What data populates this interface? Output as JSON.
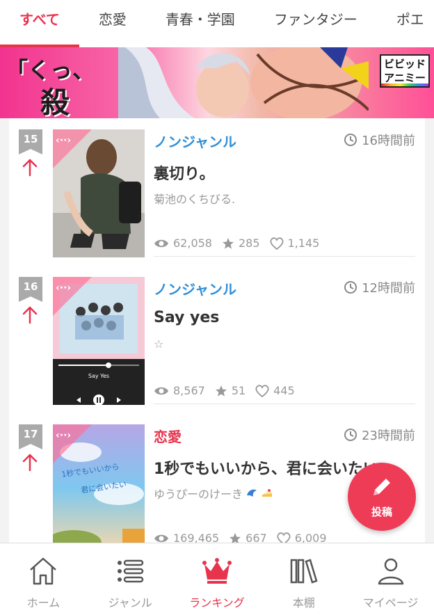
{
  "tabs": [
    {
      "label": "すべて",
      "active": true
    },
    {
      "label": "恋愛",
      "active": false
    },
    {
      "label": "青春・学園",
      "active": false
    },
    {
      "label": "ファンタジー",
      "active": false
    },
    {
      "label": "ポエ",
      "active": false
    }
  ],
  "banner": {
    "line1": "「くっ、",
    "line2": "殺せ!」",
    "logo_line1": "ビビッド",
    "logo_line2": "アニミー"
  },
  "items": [
    {
      "rank": "15",
      "trend": "up",
      "genre": "ノンジャンル",
      "time": "16時間前",
      "title": "裏切り。",
      "author": "菊池のくちびる.",
      "views": "62,058",
      "stars": "285",
      "likes": "1,145"
    },
    {
      "rank": "16",
      "trend": "up",
      "genre": "ノンジャンル",
      "time": "12時間前",
      "title": "Say yes",
      "author": "☆",
      "views": "8,567",
      "stars": "51",
      "likes": "445",
      "thumb_song": "Say Yes"
    },
    {
      "rank": "17",
      "trend": "up",
      "genre": "恋愛",
      "time": "23時間前",
      "title": "1秒でもいいから、君に会いたい",
      "author": "ゆうぴーのけーき",
      "views": "169,465",
      "stars": "667",
      "likes": "6,009",
      "thumb_line1": "1秒でもいいから",
      "thumb_line2": "君に会いたい"
    }
  ],
  "fab": {
    "label": "投稿",
    "icon": "pencil-icon"
  },
  "bottom_nav": [
    {
      "label": "ホーム",
      "icon": "home-icon",
      "active": false
    },
    {
      "label": "ジャンル",
      "icon": "list-icon",
      "active": false
    },
    {
      "label": "ランキング",
      "icon": "crown-icon",
      "active": true
    },
    {
      "label": "本棚",
      "icon": "bookshelf-icon",
      "active": false
    },
    {
      "label": "マイページ",
      "icon": "person-icon",
      "active": false
    }
  ],
  "colors": {
    "accent": "#e8334d",
    "genre_blue": "#2f8fd8",
    "rank_badge": "#aaaaaa",
    "fab": "#ee3b56"
  }
}
